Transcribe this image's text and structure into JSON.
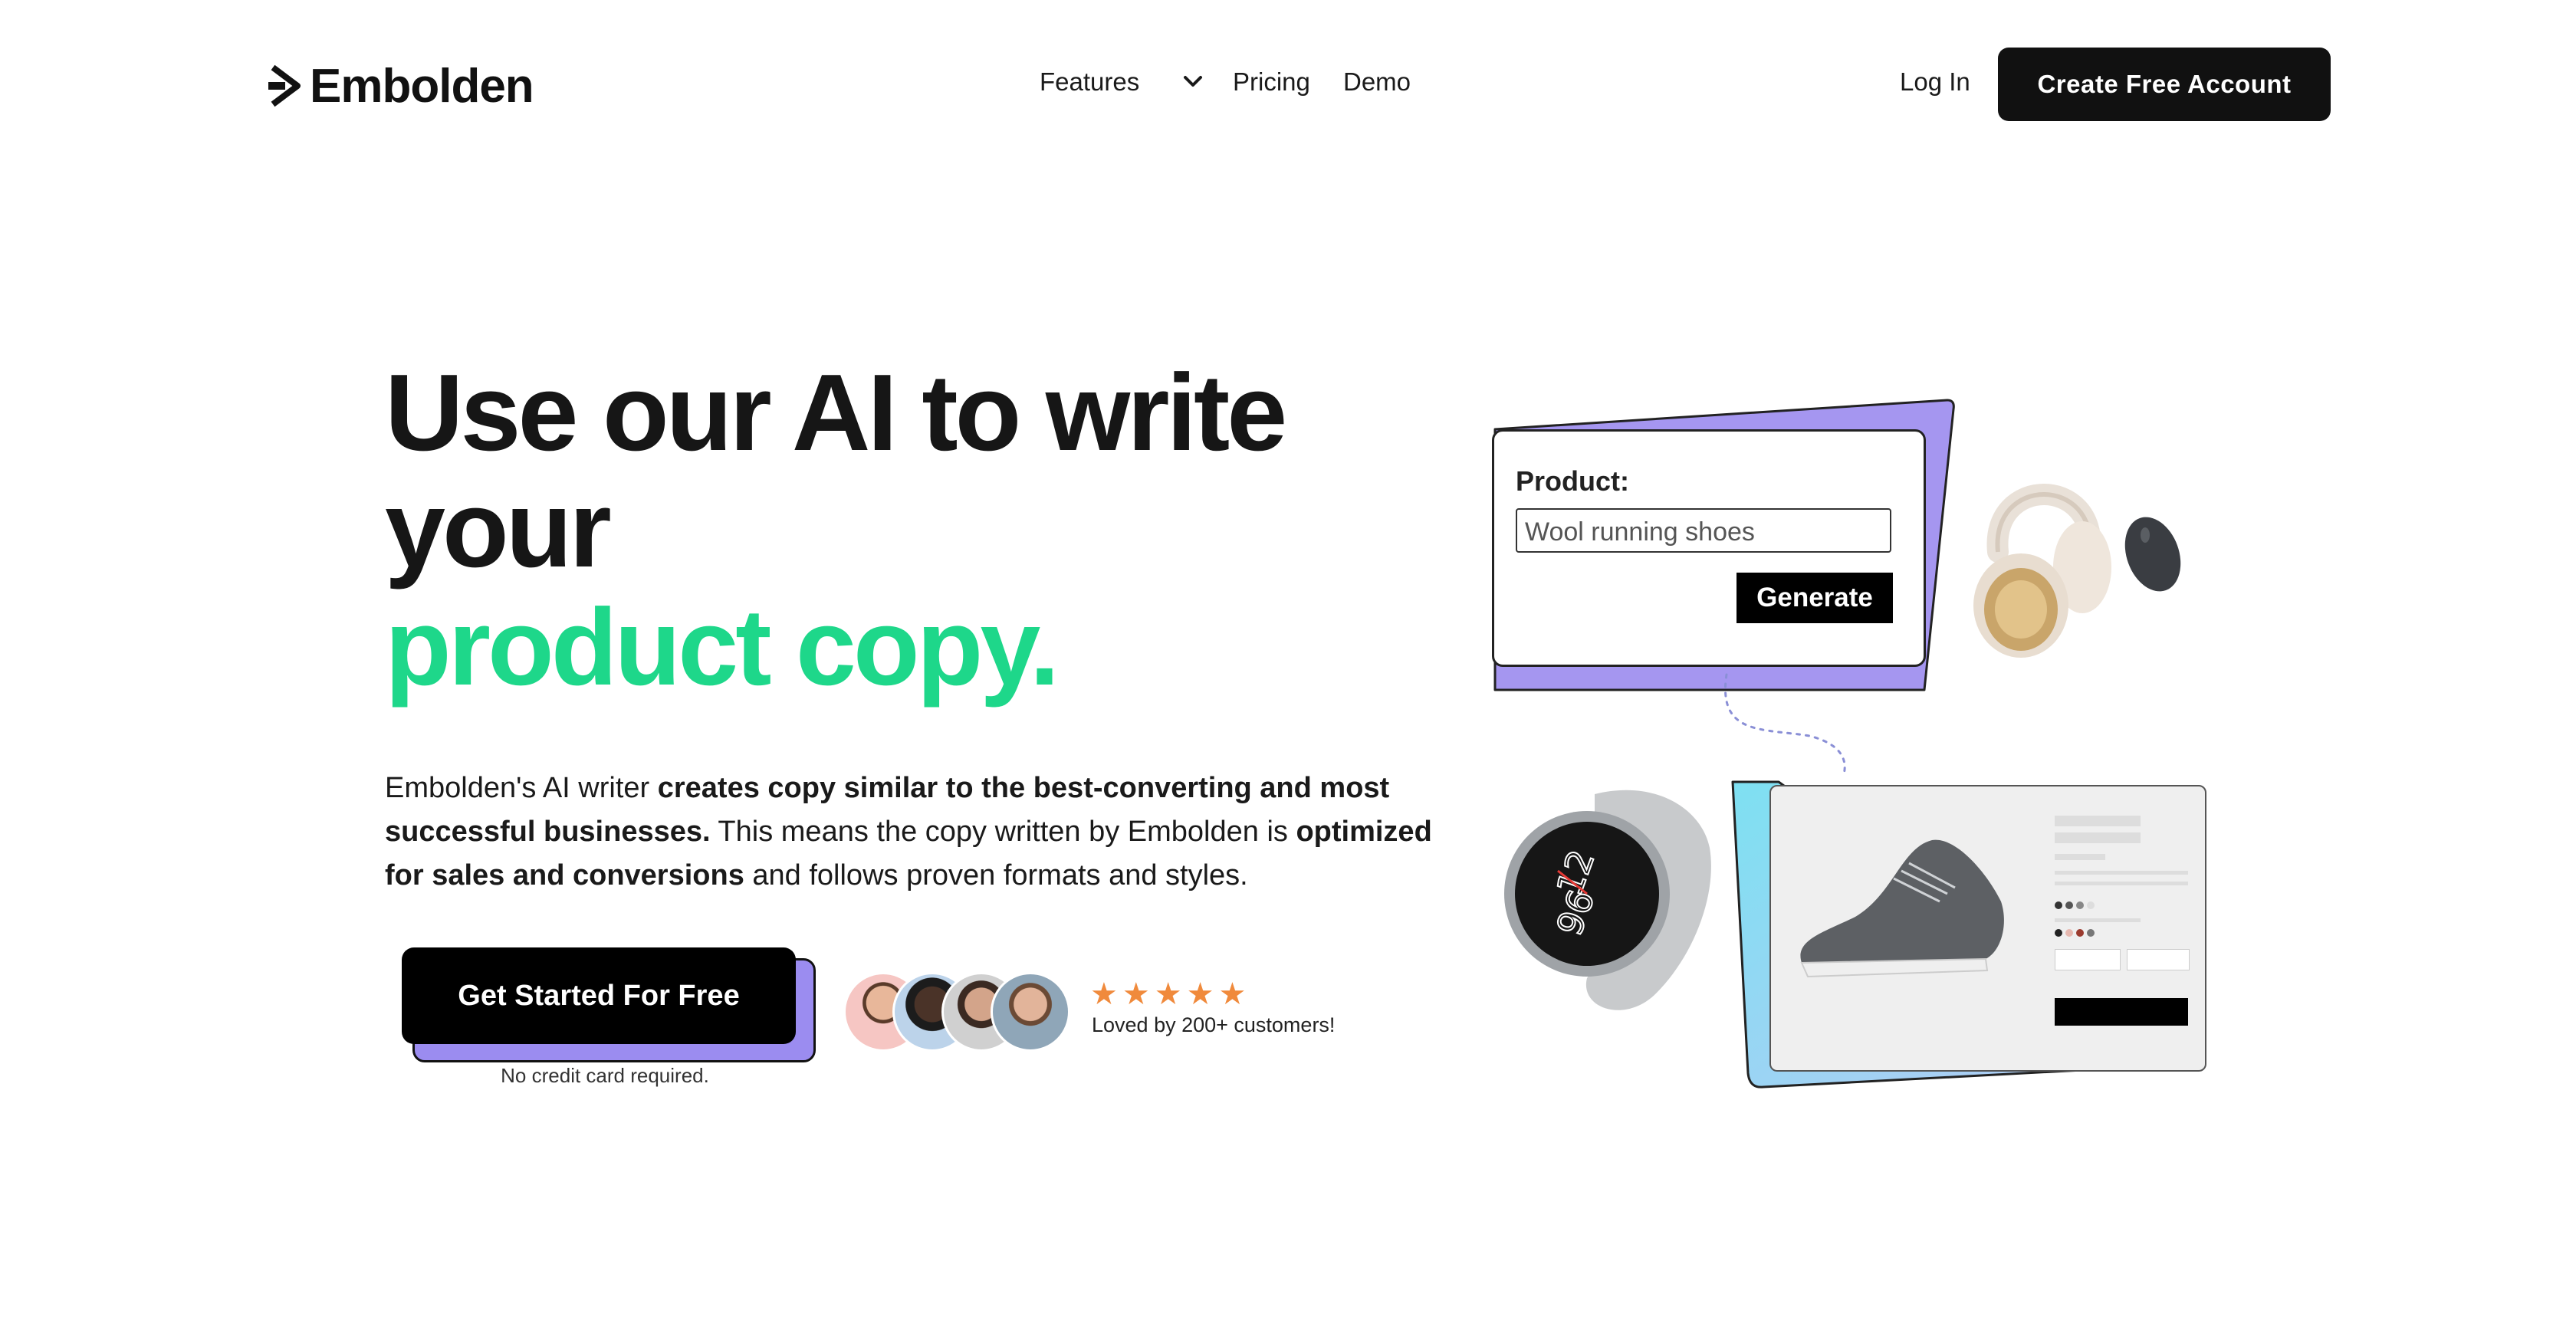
{
  "nav": {
    "brand": "Embolden",
    "features": "Features",
    "pricing": "Pricing",
    "demo": "Demo",
    "login": "Log In",
    "create_account": "Create Free Account"
  },
  "hero": {
    "line1": "Use our AI to write",
    "line2": "your",
    "line3": "product copy.",
    "para": {
      "p1": "Embolden's AI writer ",
      "b1": "creates copy similar to the best-converting and most successful businesses.",
      "p2": " This means the copy written by Embolden is ",
      "b2": "optimized for sales and conversions",
      "p3": " and follows proven formats and styles."
    },
    "cta": "Get Started For Free",
    "no_cc": "No credit card required.",
    "loved": "Loved by 200+ customers!",
    "rating": 5
  },
  "demo": {
    "product_label": "Product:",
    "product_value": "Wool running shoes",
    "generate": "Generate"
  },
  "colors": {
    "accent_green": "#1ed78a",
    "purple": "#9b8cf0",
    "star": "#f08a3c"
  },
  "icons": [
    "chevron-down-icon",
    "star-icon",
    "logo-icon"
  ]
}
